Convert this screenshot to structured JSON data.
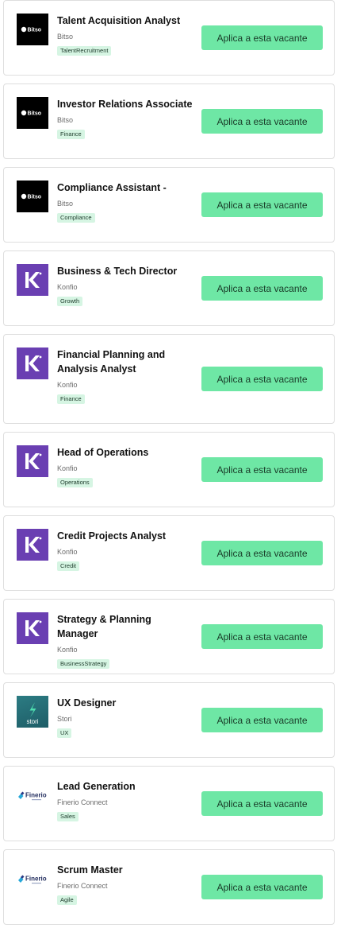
{
  "jobs": [
    {
      "title": "Talent Acquisition Analyst",
      "company": "Bitso",
      "tag": "TalentRecruitment",
      "logo": "bitso",
      "logo_text": "Bitso",
      "apply_label": "Aplica a esta vacante"
    },
    {
      "title": "Investor Relations Associate",
      "company": "Bitso",
      "tag": "Finance",
      "logo": "bitso",
      "logo_text": "Bitso",
      "apply_label": "Aplica a esta vacante"
    },
    {
      "title": "Compliance Assistant -",
      "company": "Bitso",
      "tag": "Compliance",
      "logo": "bitso",
      "logo_text": "Bitso",
      "apply_label": "Aplica a esta vacante"
    },
    {
      "title": "Business & Tech Director",
      "company": "Konfio",
      "tag": "Growth",
      "logo": "konfio",
      "logo_text": "",
      "apply_label": "Aplica a esta vacante"
    },
    {
      "title": "Financial Planning and Analysis Analyst",
      "company": "Konfio",
      "tag": "Finance",
      "logo": "konfio",
      "logo_text": "",
      "apply_label": "Aplica a esta vacante"
    },
    {
      "title": "Head of Operations",
      "company": "Konfio",
      "tag": "Operations",
      "logo": "konfio",
      "logo_text": "",
      "apply_label": "Aplica a esta vacante"
    },
    {
      "title": "Credit Projects Analyst",
      "company": "Konfio",
      "tag": "Credit",
      "logo": "konfio",
      "logo_text": "",
      "apply_label": "Aplica a esta vacante"
    },
    {
      "title": "Strategy & Planning Manager",
      "company": "Konfio",
      "tag": "BusinessStrategy",
      "logo": "konfio",
      "logo_text": "",
      "apply_label": "Aplica a esta vacante"
    },
    {
      "title": "UX Designer",
      "company": "Stori",
      "tag": "UX",
      "logo": "stori",
      "logo_text": "stori",
      "apply_label": "Aplica a esta vacante"
    },
    {
      "title": "Lead Generation",
      "company": "Finerio Connect",
      "tag": "Sales",
      "logo": "finerio",
      "logo_text": "Finerio",
      "apply_label": "Aplica a esta vacante"
    },
    {
      "title": "Scrum Master",
      "company": "Finerio Connect",
      "tag": "Agile",
      "logo": "finerio",
      "logo_text": "Finerio",
      "apply_label": "Aplica a esta vacante"
    }
  ],
  "colors": {
    "button": "#6ee7a5",
    "tag_bg": "#d6f5e3",
    "konfio": "#6a3fb2",
    "card_border": "#dedede"
  }
}
